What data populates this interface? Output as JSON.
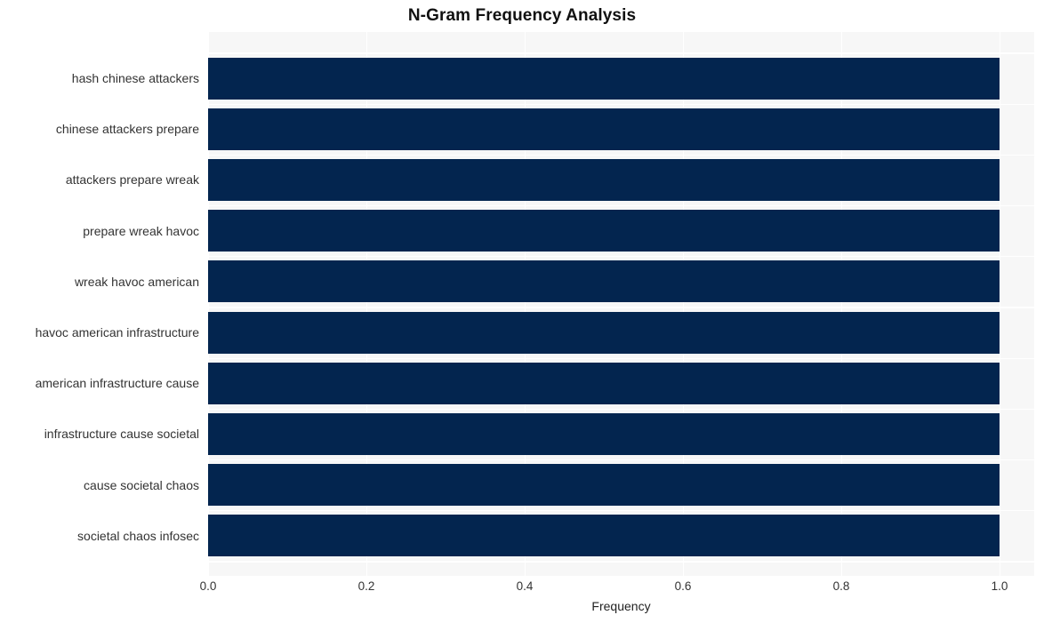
{
  "chart_data": {
    "type": "bar",
    "orientation": "horizontal",
    "title": "N-Gram Frequency Analysis",
    "xlabel": "Frequency",
    "ylabel": "",
    "categories": [
      "hash chinese attackers",
      "chinese attackers prepare",
      "attackers prepare wreak",
      "prepare wreak havoc",
      "wreak havoc american",
      "havoc american infrastructure",
      "american infrastructure cause",
      "infrastructure cause societal",
      "cause societal chaos",
      "societal chaos infosec"
    ],
    "values": [
      1.0,
      1.0,
      1.0,
      1.0,
      1.0,
      1.0,
      1.0,
      1.0,
      1.0,
      1.0
    ],
    "xlim": [
      0.0,
      1.0
    ],
    "xticks": [
      0.0,
      0.2,
      0.4,
      0.6,
      0.8,
      1.0
    ],
    "xtick_labels": [
      "0.0",
      "0.2",
      "0.4",
      "0.6",
      "0.8",
      "1.0"
    ],
    "grid": true,
    "legend": false,
    "bar_color": "#03254f",
    "plot_background": "#f7f7f7",
    "figure_background": "#ffffff",
    "gridline_color": "#ffffff"
  }
}
